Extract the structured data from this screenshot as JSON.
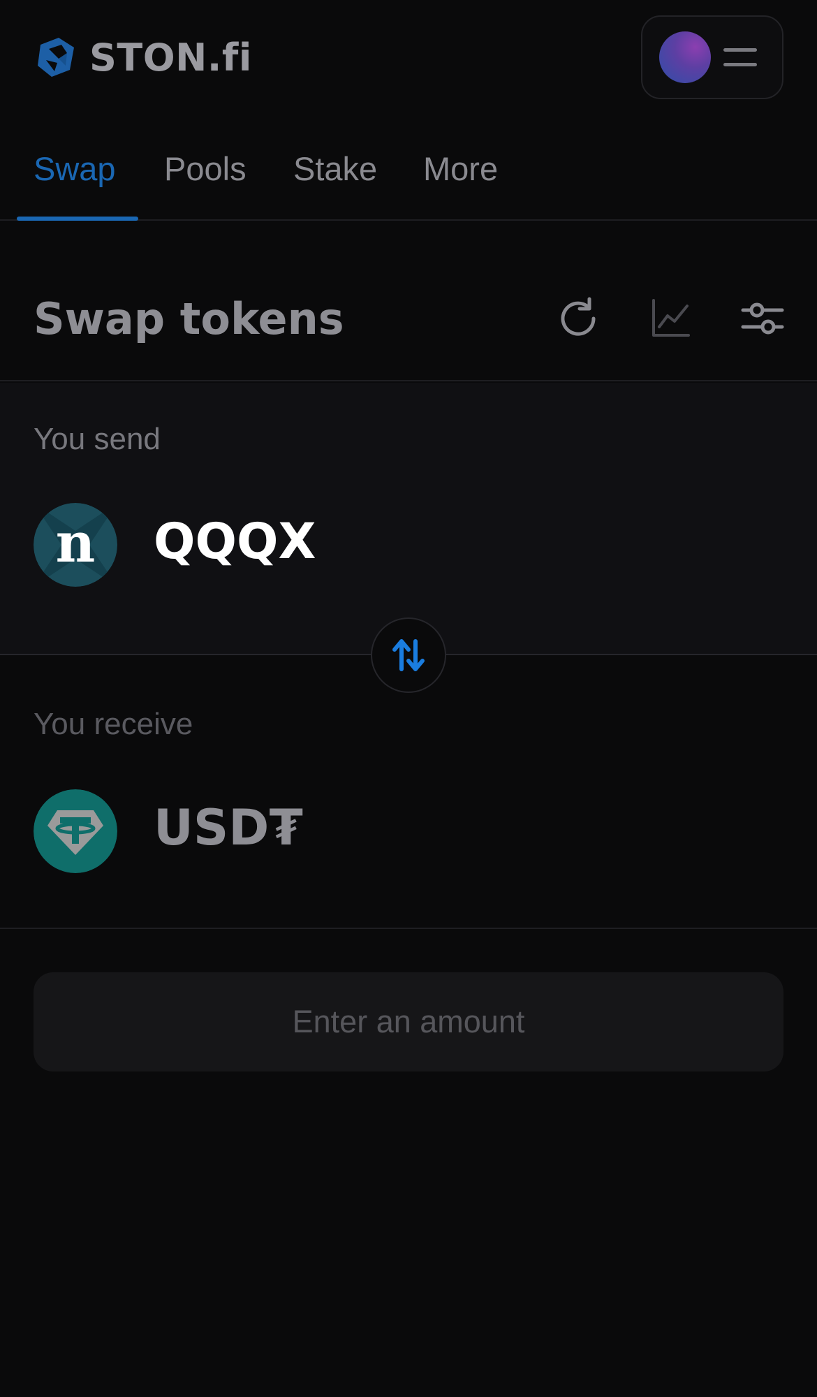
{
  "header": {
    "logo_text": "STON.fi",
    "logo_icon": "ston-logo-icon",
    "avatar_icon": "wallet-avatar",
    "menu_icon": "hamburger-menu-icon"
  },
  "tabs": [
    {
      "label": "Swap",
      "active": true
    },
    {
      "label": "Pools",
      "active": false
    },
    {
      "label": "Stake",
      "active": false
    },
    {
      "label": "More",
      "active": false
    }
  ],
  "swap": {
    "title": "Swap tokens",
    "actions": [
      "refresh-icon",
      "chart-icon",
      "settings-sliders-icon"
    ],
    "send": {
      "label": "You send",
      "token": "QQQX",
      "token_icon": "qqqx-token-icon"
    },
    "switch_icon": "swap-direction-icon",
    "receive": {
      "label": "You receive",
      "token": "USD₮",
      "token_icon": "usdt-token-icon"
    },
    "submit_label": "Enter an amount"
  },
  "colors": {
    "background": "#0a0a0b",
    "accent": "#1a67b3",
    "send_panel": "#101013",
    "button_bg": "#161618"
  }
}
